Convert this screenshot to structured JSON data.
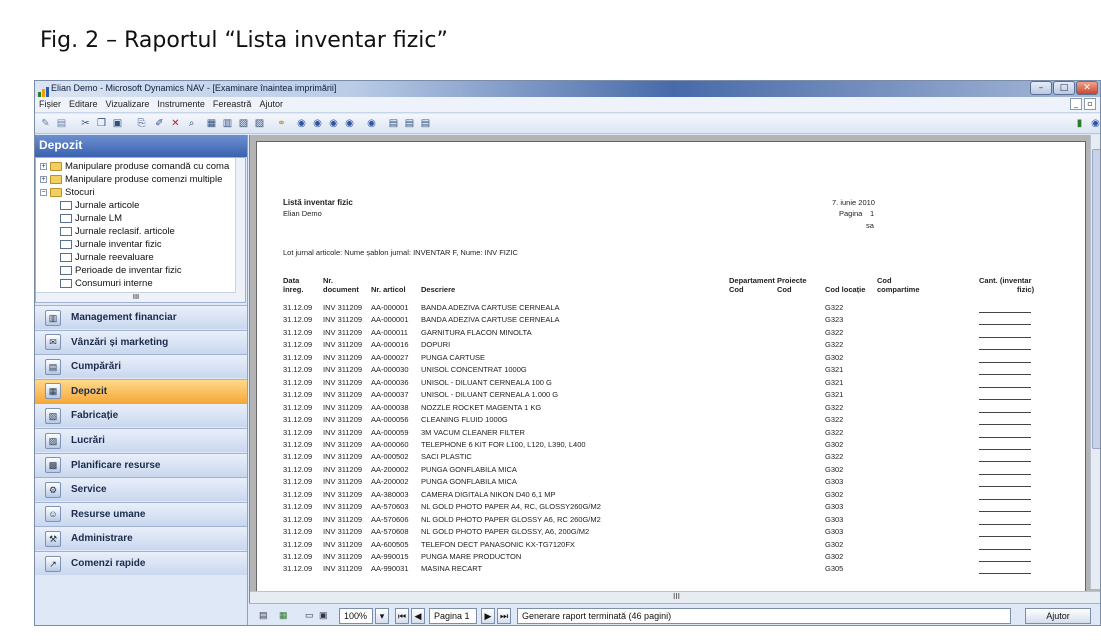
{
  "caption": "Fig. 2 – Raportul  “Lista inventar fizic”",
  "window": {
    "title": "Elian Demo - Microsoft Dynamics NAV - [Examinare înaintea imprimării]",
    "menu": [
      "Fișier",
      "Editare",
      "Vizualizare",
      "Instrumente",
      "Fereastră",
      "Ajutor"
    ]
  },
  "nav": {
    "header": "Depozit",
    "tree": [
      {
        "label": "Manipulare produse comandă cu coma",
        "type": "folder",
        "expander": "+"
      },
      {
        "label": "Manipulare produse comenzi multiple",
        "type": "folder",
        "expander": "+"
      },
      {
        "label": "Stocuri",
        "type": "folder",
        "expander": "-"
      },
      {
        "label": "Jurnale articole",
        "type": "doc"
      },
      {
        "label": "Jurnale LM",
        "type": "doc"
      },
      {
        "label": "Jurnale reclasif. articole",
        "type": "doc"
      },
      {
        "label": "Jurnale inventar fizic",
        "type": "doc"
      },
      {
        "label": "Jurnale reevaluare",
        "type": "doc"
      },
      {
        "label": "Perioade de inventar fizic",
        "type": "doc"
      },
      {
        "label": "Consumuri interne",
        "type": "doc"
      },
      {
        "label": "Istoric",
        "type": "folder",
        "expander": "+"
      }
    ],
    "buttons": [
      {
        "label": "Management financiar",
        "icon": "ledger-icon"
      },
      {
        "label": "Vânzări și marketing",
        "icon": "sales-icon"
      },
      {
        "label": "Cumpărări",
        "icon": "purchase-icon"
      },
      {
        "label": "Depozit",
        "icon": "warehouse-icon",
        "active": true
      },
      {
        "label": "Fabricație",
        "icon": "factory-icon"
      },
      {
        "label": "Lucrări",
        "icon": "jobs-icon"
      },
      {
        "label": "Planificare resurse",
        "icon": "planning-icon"
      },
      {
        "label": "Service",
        "icon": "service-icon"
      },
      {
        "label": "Resurse umane",
        "icon": "hr-icon"
      },
      {
        "label": "Administrare",
        "icon": "admin-icon"
      },
      {
        "label": "Comenzi rapide",
        "icon": "shortcut-icon"
      }
    ]
  },
  "report": {
    "title": "Listă inventar fizic",
    "company": "Elian Demo",
    "date": "7. iunie 2010",
    "page_label": "Pagina",
    "page_number": "1",
    "user": "sa",
    "filter": "Lot jurnal articole: Nume șablon jurnal: INVENTAR F, Nume: INV FIZIC",
    "columns": {
      "date": [
        "Data",
        "înreg."
      ],
      "doc": [
        "Nr.",
        "document"
      ],
      "item": "Nr. articol",
      "desc": "Descriere",
      "dept": [
        "Departament",
        "Cod"
      ],
      "proj": [
        "Proiecte",
        "Cod"
      ],
      "loc": "Cod locație",
      "bin": [
        "Cod",
        "compartime"
      ],
      "qty": [
        "Cant. (inventar",
        "fizic)"
      ]
    },
    "rows": [
      [
        "31.12.09",
        "INV 311209",
        "AA-000001",
        "BANDA ADEZIVA CARTUSE CERNEALA",
        "G322"
      ],
      [
        "31.12.09",
        "INV 311209",
        "AA-000001",
        "BANDA ADEZIVA CARTUSE CERNEALA",
        "G323"
      ],
      [
        "31.12.09",
        "INV 311209",
        "AA-000011",
        "GARNITURA FLACON MINOLTA",
        "G322"
      ],
      [
        "31.12.09",
        "INV 311209",
        "AA-000016",
        "DOPURI",
        "G322"
      ],
      [
        "31.12.09",
        "INV 311209",
        "AA-000027",
        "PUNGA CARTUSE",
        "G302"
      ],
      [
        "31.12.09",
        "INV 311209",
        "AA-000030",
        "UNISOL CONCENTRAT 1000G",
        "G321"
      ],
      [
        "31.12.09",
        "INV 311209",
        "AA-000036",
        "UNISOL - DILUANT CERNEALA 100 G",
        "G321"
      ],
      [
        "31.12.09",
        "INV 311209",
        "AA-000037",
        "UNISOL - DILUANT CERNEALA 1.000 G",
        "G321"
      ],
      [
        "31.12.09",
        "INV 311209",
        "AA-000038",
        "NOZZLE ROCKET MAGENTA 1 KG",
        "G322"
      ],
      [
        "31.12.09",
        "INV 311209",
        "AA-000056",
        "CLEANING FLUID 1000G",
        "G322"
      ],
      [
        "31.12.09",
        "INV 311209",
        "AA-000059",
        "3M VACUM CLEANER FILTER",
        "G322"
      ],
      [
        "31.12.09",
        "INV 311209",
        "AA-000060",
        "TELEPHONE 6 KIT FOR L100, L120, L390, L400",
        "G302"
      ],
      [
        "31.12.09",
        "INV 311209",
        "AA-000502",
        "SACI PLASTIC",
        "G322"
      ],
      [
        "31.12.09",
        "INV 311209",
        "AA-200002",
        "PUNGA GONFLABILA MICA",
        "G302"
      ],
      [
        "31.12.09",
        "INV 311209",
        "AA-200002",
        "PUNGA GONFLABILA MICA",
        "G303"
      ],
      [
        "31.12.09",
        "INV 311209",
        "AA-380003",
        "CAMERA DIGITALA NIKON D40 6,1 MP",
        "G302"
      ],
      [
        "31.12.09",
        "INV 311209",
        "AA-570603",
        "NL GOLD PHOTO PAPER A4, RC, GLOSSY260G/M2",
        "G303"
      ],
      [
        "31.12.09",
        "INV 311209",
        "AA-570606",
        "NL GOLD PHOTO PAPER GLOSSY A6, RC 260G/M2",
        "G303"
      ],
      [
        "31.12.09",
        "INV 311209",
        "AA-570608",
        "NL GOLD PHOTO PAPER GLOSSY, A6, 200G/M2",
        "G303"
      ],
      [
        "31.12.09",
        "INV 311209",
        "AA-600505",
        "TELEFON DECT PANASONIC KX-TG7120FX",
        "G302"
      ],
      [
        "31.12.09",
        "INV 311209",
        "AA-990015",
        "PUNGA MARE PRODUCTON",
        "G302"
      ],
      [
        "31.12.09",
        "INV 311209",
        "AA-990031",
        "MASINA RECART",
        "G305"
      ]
    ]
  },
  "status": {
    "zoom": "100%",
    "page": "Pagina 1",
    "message": "Generare raport terminată (46 pagini)",
    "help_button": "Ajutor"
  }
}
